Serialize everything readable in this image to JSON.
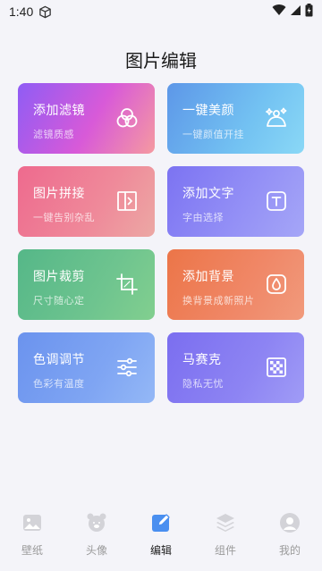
{
  "status": {
    "time": "1:40"
  },
  "header": {
    "title": "图片编辑"
  },
  "cards": [
    {
      "title": "添加滤镜",
      "subtitle": "滤镜质感",
      "icon": "three-circles-icon"
    },
    {
      "title": "一键美颜",
      "subtitle": "一键颜值开挂",
      "icon": "face-sparkle-icon"
    },
    {
      "title": "图片拼接",
      "subtitle": "一键告别杂乱",
      "icon": "collage-icon"
    },
    {
      "title": "添加文字",
      "subtitle": "字由选择",
      "icon": "text-box-icon"
    },
    {
      "title": "图片裁剪",
      "subtitle": "尺寸随心定",
      "icon": "crop-icon"
    },
    {
      "title": "添加背景",
      "subtitle": "换背景成新照片",
      "icon": "drop-icon"
    },
    {
      "title": "色调调节",
      "subtitle": "色彩有温度",
      "icon": "sliders-icon"
    },
    {
      "title": "马赛克",
      "subtitle": "隐私无忧",
      "icon": "mosaic-icon"
    }
  ],
  "tabs": [
    {
      "label": "壁纸",
      "icon": "image-icon",
      "active": false
    },
    {
      "label": "头像",
      "icon": "bear-icon",
      "active": false
    },
    {
      "label": "编辑",
      "icon": "edit-icon",
      "active": true
    },
    {
      "label": "组件",
      "icon": "layers-icon",
      "active": false
    },
    {
      "label": "我的",
      "icon": "user-icon",
      "active": false
    }
  ],
  "colors": {
    "active_tab": "#4a8ff0",
    "inactive_tab": "#d3d3d8"
  }
}
